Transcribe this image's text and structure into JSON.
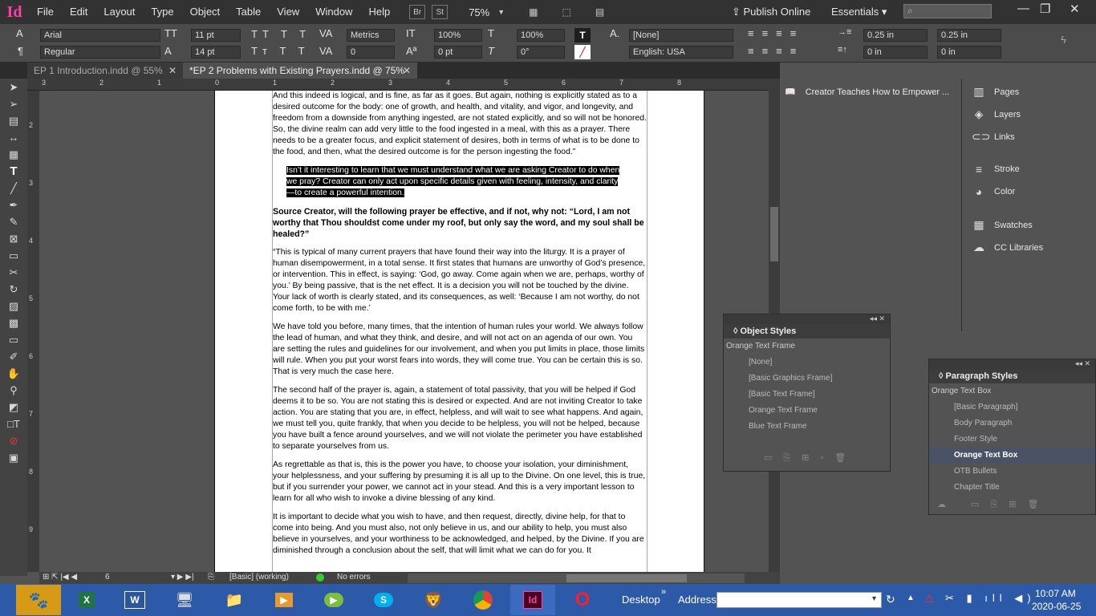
{
  "menubar": {
    "logo": "Id",
    "items": [
      "File",
      "Edit",
      "Layout",
      "Type",
      "Object",
      "Table",
      "View",
      "Window",
      "Help"
    ],
    "bridge_btn": "Br",
    "stock_btn": "St",
    "zoom": "75%",
    "publish": "Publish Online",
    "workspace": "Essentials"
  },
  "control": {
    "font": "Arial",
    "style": "Regular",
    "size": "11 pt",
    "leading": "14 pt",
    "kerning": "Metrics",
    "tracking": "0",
    "vscale": "100%",
    "hscale": "100%",
    "baseline": "0 pt",
    "skew": "0°",
    "char_style": "[None]",
    "language": "English: USA",
    "indent_left": "0.25 in",
    "indent_right": "0.25 in",
    "space_before": "0 in",
    "space_after": "0 in"
  },
  "tabs": [
    {
      "label": "EP 1 Introduction.indd @ 55%"
    },
    {
      "label": "*EP 2 Problems with Existing Prayers.indd @ 75%"
    }
  ],
  "ruler": {
    "top": [
      "3",
      "2",
      "1",
      "0",
      "1",
      "2",
      "3",
      "4",
      "5",
      "6",
      "7",
      "8"
    ],
    "left": [
      "2",
      "3",
      "4",
      "5",
      "6",
      "7",
      "8",
      "9"
    ]
  },
  "document": {
    "p1": "And this indeed is logical, and is fine, as far as it goes. But again, nothing is explicitly stated as to a desired outcome for the body: one of growth, and health, and vitality, and vigor, and longevity, and freedom from a downside from anything ingested, are not stated explicitly, and so will not be honored. So, the divine realm can add very little to the food ingested in a meal, with this as a prayer. There needs to be a greater focus, and explicit statement of desires, both in terms of what is to be done to the food, and then, what the desired outcome is for the person ingesting the food.”",
    "highlight": "Isn’t it interesting to learn that we must understand what we are asking Creator to do when we pray? Creator can only act upon specific details given with feeling, intensity, and clarity—to create a powerful intention.",
    "question": "Source Creator, will the following prayer be effective, and if not, why not: “Lord, I am not worthy that Thou shouldst come under my roof, but only say the word, and my soul shall be healed?”",
    "p2": "“This is typical of many current prayers that have found their way into the liturgy. It is a prayer of human disempowerment, in a total sense. It first states that humans are unworthy of God’s presence, or intervention. This in effect, is saying: ‘God, go away. Come again when we are, perhaps, worthy of you.’ By being passive, that is the net effect. It is a decision you will not be touched by the divine. Your lack of worth is clearly stated, and its consequences, as well: ‘Because I am not worthy, do not come forth, to be with me.’",
    "p3": "We have told you before, many times, that the intention of human rules your world. We always follow the lead of human, and what they think, and desire, and will not act on an agenda of our own. You are setting the rules and guidelines for our involvement, and when you put limits in place, those limits will rule. When you put your worst fears into words, they will come true. You can be certain this is so. That is very much the case here.",
    "p4": "The second half of the prayer is, again, a statement of total passivity, that you will be helped if God deems it to be so. You are not stating this is desired or expected. And are not inviting Creator to take action. You are stating that you are, in effect, helpless, and will wait to see what happens. And again, we must tell you, quite frankly, that when you decide to be helpless, you will not be helped, because you have built a fence around yourselves, and we will not violate the perimeter you have established to separate yourselves from us.",
    "p5": "As regrettable as that is, this is the power you have, to choose your isolation, your diminishment, your helplessness, and your suffering by presuming it is all up to the Divine. On one level, this is true, but if you surrender your power, we cannot act in your stead. And this is a very important lesson to learn for all who wish to invoke a divine blessing of any kind.",
    "p6": "It is important to decide what you wish to have, and then request, directly, divine help, for that to come into being. And you must also, not only believe in us, and our ability to help, you must also believe in yourselves, and your worthiness to be acknowledged, and helped, by the Divine. If you are diminished through a conclusion about the self, that will limit what we can do for you. It"
  },
  "status": {
    "page": "6",
    "style": "[Basic] (working)",
    "errors": "No errors"
  },
  "dock": {
    "creator": "Creator Teaches How to Empower ...",
    "items": [
      "Pages",
      "Layers",
      "Links",
      "Stroke",
      "Color",
      "Swatches",
      "CC Libraries"
    ]
  },
  "object_styles": {
    "title": "Object Styles",
    "current": "Orange Text Frame",
    "items": [
      "[None]",
      "[Basic Graphics Frame]",
      "[Basic Text Frame]",
      "Orange Text Frame",
      "Blue Text Frame"
    ]
  },
  "paragraph_styles": {
    "title": "Paragraph Styles",
    "current": "Orange Text Box",
    "items": [
      "[Basic Paragraph]",
      "Body Paragraph",
      "Footer Style",
      "Orange Text Box",
      "OTB Bullets",
      "Chapter Title"
    ]
  },
  "taskbar": {
    "desktop": "Desktop",
    "address": "Address",
    "time": "10:07 AM",
    "date": "2020-06-25"
  },
  "colors": {
    "accent": "#ff3fa4",
    "taskbar": "#2c5aa8",
    "selected_style": "#4a5266"
  }
}
